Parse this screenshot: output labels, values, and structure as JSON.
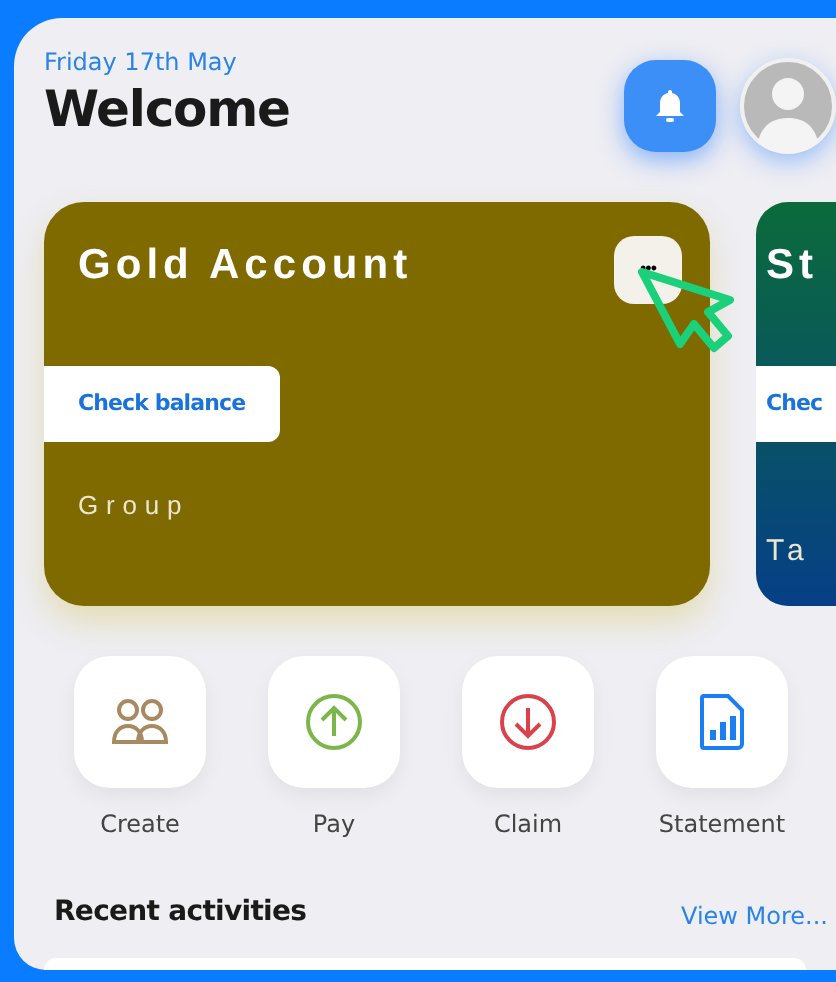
{
  "header": {
    "date": "Friday 17th May",
    "title": "Welcome"
  },
  "accounts": [
    {
      "kind": "solid",
      "name": "Gold Account",
      "button": "Check balance",
      "type": "Group",
      "color": "#7f6a00",
      "menu": "•••"
    },
    {
      "kind": "gradient",
      "name": "St",
      "button": "Chec",
      "type": "Ta",
      "color": "#0b6b3a"
    }
  ],
  "actions": [
    {
      "kind": "people",
      "label": "Create"
    },
    {
      "kind": "up",
      "label": "Pay"
    },
    {
      "kind": "down",
      "label": "Claim"
    },
    {
      "kind": "report",
      "label": "Statement"
    }
  ],
  "recent": {
    "title": "Recent activities",
    "link": "View More..."
  }
}
